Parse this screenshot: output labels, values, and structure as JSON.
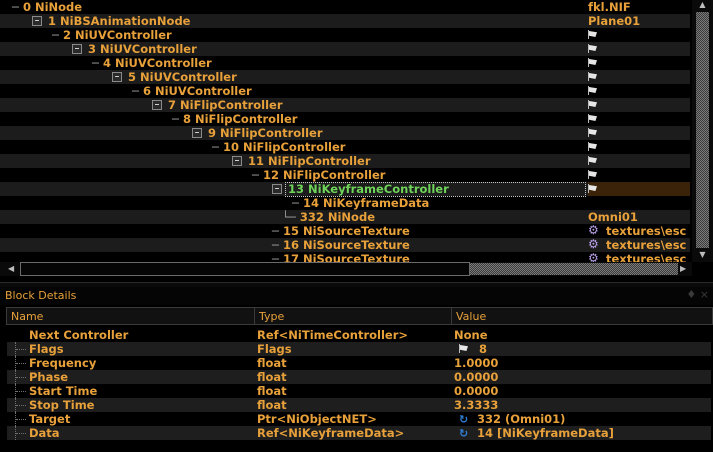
{
  "tree": {
    "rows": [
      {
        "label": "0 NiNode",
        "col2": "fkl.NIF",
        "col2_icon": ""
      },
      {
        "label": "1 NiBSAnimationNode",
        "col2": "Plane01",
        "col2_icon": ""
      },
      {
        "label": "2 NiUVController",
        "col2": "",
        "col2_icon": "flag-icon"
      },
      {
        "label": "3 NiUVController",
        "col2": "",
        "col2_icon": "flag-icon"
      },
      {
        "label": "4 NiUVController",
        "col2": "",
        "col2_icon": "flag-icon"
      },
      {
        "label": "5 NiUVController",
        "col2": "",
        "col2_icon": "flag-icon"
      },
      {
        "label": "6 NiUVController",
        "col2": "",
        "col2_icon": "flag-icon"
      },
      {
        "label": "7 NiFlipController",
        "col2": "",
        "col2_icon": "flag-icon"
      },
      {
        "label": "8 NiFlipController",
        "col2": "",
        "col2_icon": "flag-icon"
      },
      {
        "label": "9 NiFlipController",
        "col2": "",
        "col2_icon": "flag-icon"
      },
      {
        "label": "10 NiFlipController",
        "col2": "",
        "col2_icon": "flag-icon"
      },
      {
        "label": "11 NiFlipController",
        "col2": "",
        "col2_icon": "flag-icon"
      },
      {
        "label": "12 NiFlipController",
        "col2": "",
        "col2_icon": "flag-icon"
      },
      {
        "label": "13 NiKeyframeController",
        "col2": "",
        "col2_icon": "flag-icon"
      },
      {
        "label": "14 NiKeyframeData",
        "col2": "",
        "col2_icon": ""
      },
      {
        "label": "332 NiNode",
        "col2": "Omni01",
        "col2_icon": ""
      },
      {
        "label": "15 NiSourceTexture",
        "col2": "textures\\esc",
        "col2_icon": "gear-icon"
      },
      {
        "label": "16 NiSourceTexture",
        "col2": "textures\\esc",
        "col2_icon": "gear-icon"
      },
      {
        "label": "17 NiSourceTexture",
        "col2": "textures\\esc",
        "col2_icon": "gear-icon"
      }
    ],
    "selected_index": 13
  },
  "details": {
    "title": "Block Details",
    "controls": "♦ ×",
    "columns": {
      "name": "Name",
      "type": "Type",
      "value": "Value"
    },
    "rows": [
      {
        "name": "Next Controller",
        "type": "Ref<NiTimeController>",
        "value": "None",
        "icon": ""
      },
      {
        "name": "Flags",
        "type": "Flags",
        "value": "8",
        "icon": "flag-icon"
      },
      {
        "name": "Frequency",
        "type": "float",
        "value": "1.0000",
        "icon": ""
      },
      {
        "name": "Phase",
        "type": "float",
        "value": "0.0000",
        "icon": ""
      },
      {
        "name": "Start Time",
        "type": "float",
        "value": "0.0000",
        "icon": ""
      },
      {
        "name": "Stop Time",
        "type": "float",
        "value": "3.3333",
        "icon": ""
      },
      {
        "name": "Target",
        "type": "Ptr<NiObjectNET>",
        "value": "332 (Omni01)",
        "icon": "link-icon"
      },
      {
        "name": "Data",
        "type": "Ref<NiKeyframeData>",
        "value": "14 [NiKeyframeData]",
        "icon": "link-icon"
      }
    ]
  },
  "colors": {
    "text": "#e8a13a",
    "selected": "#6fd35a",
    "background": "#000000"
  }
}
